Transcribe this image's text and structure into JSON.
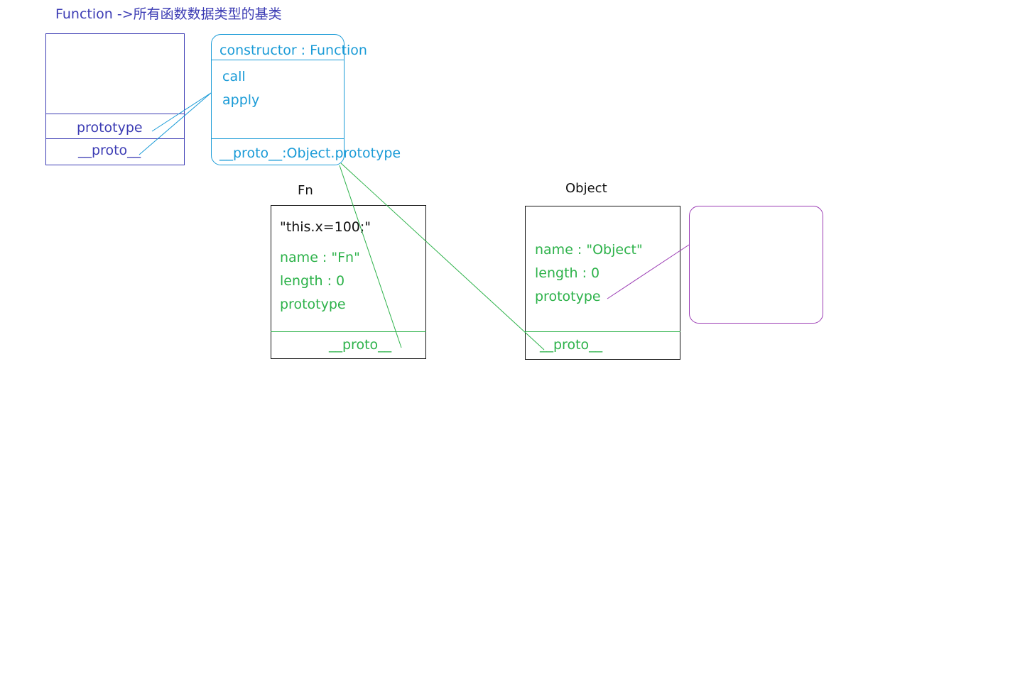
{
  "title": "Function ->所有函数数据类型的基类",
  "function_box": {
    "prototype": "prototype",
    "proto": "__proto__"
  },
  "function_prototype_box": {
    "constructor": "constructor : Function",
    "methods": [
      "call",
      "apply"
    ],
    "proto": "__proto__:Object.prototype"
  },
  "fn_box": {
    "label": "Fn",
    "body": "\"this.x=100;\"",
    "props": [
      "name : \"Fn\"",
      "length : 0",
      "prototype"
    ],
    "proto": "__proto__"
  },
  "object_box": {
    "label": "Object",
    "props": [
      "name : \"Object\"",
      "length : 0",
      "prototype"
    ],
    "proto": "__proto__"
  },
  "colors": {
    "indigo": "#3c3cb4",
    "cyan": "#1a9bd7",
    "green": "#2db24a",
    "purple": "#9b3cb4",
    "black": "#111111"
  }
}
